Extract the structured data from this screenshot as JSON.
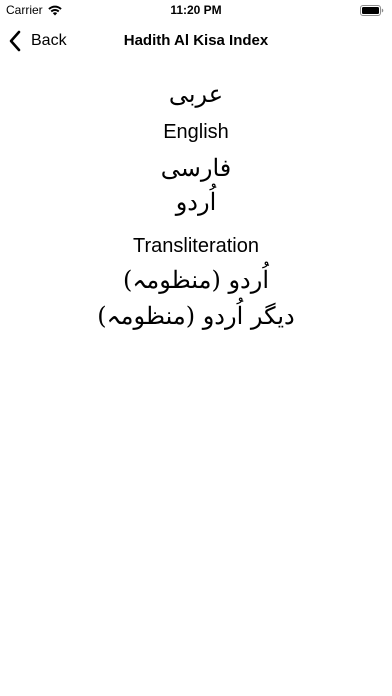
{
  "status_bar": {
    "carrier": "Carrier",
    "time": "11:20 PM"
  },
  "nav": {
    "back_label": "Back",
    "title": "Hadith Al Kisa Index"
  },
  "menu": {
    "items": [
      {
        "label": "عربی"
      },
      {
        "label": "English"
      },
      {
        "label": "فارسی"
      },
      {
        "label": "اُردو"
      },
      {
        "label": "Transliteration"
      },
      {
        "label": "اُردو (منظومہ)"
      },
      {
        "label": "دیگر اُردو (منظومہ)"
      }
    ]
  },
  "icons": {
    "wifi": "wifi-icon",
    "battery": "battery-icon",
    "back": "chevron-left-icon"
  }
}
